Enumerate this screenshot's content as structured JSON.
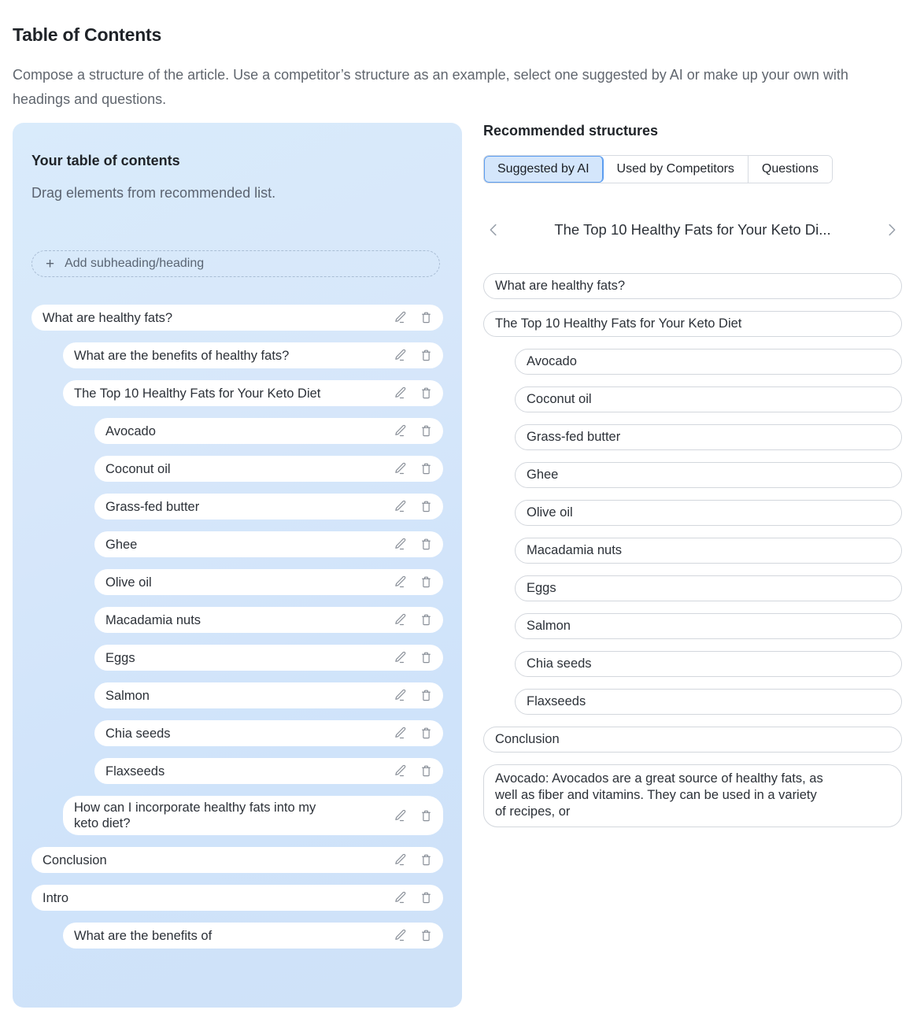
{
  "header": {
    "title": "Table of Contents",
    "description": "Compose a structure of the article. Use a competitor’s structure as an example, select one suggested by AI or make up your own with headings and questions."
  },
  "left_panel": {
    "title": "Your table of contents",
    "subtitle": "Drag elements from recommended list.",
    "add_button_label": "Add subheading/heading",
    "add_button_plus": "+",
    "edit_icon": "pencil-icon",
    "delete_icon": "trash-icon",
    "items": [
      {
        "label": "What are healthy fats?",
        "indent": 0
      },
      {
        "label": "What are the benefits of healthy fats?",
        "indent": 1
      },
      {
        "label": "The Top 10 Healthy Fats for Your Keto Diet",
        "indent": 1
      },
      {
        "label": "Avocado",
        "indent": 2
      },
      {
        "label": "Coconut oil",
        "indent": 2
      },
      {
        "label": "Grass-fed butter",
        "indent": 2
      },
      {
        "label": "Ghee",
        "indent": 2
      },
      {
        "label": "Olive oil",
        "indent": 2
      },
      {
        "label": "Macadamia nuts",
        "indent": 2
      },
      {
        "label": "Eggs",
        "indent": 2
      },
      {
        "label": "Salmon",
        "indent": 2
      },
      {
        "label": "Chia seeds",
        "indent": 2
      },
      {
        "label": "Flaxseeds",
        "indent": 2
      },
      {
        "label": "How can I incorporate healthy fats into my\nketo diet?",
        "indent": 1
      },
      {
        "label": "Conclusion",
        "indent": 0
      },
      {
        "label": "Intro",
        "indent": 0
      },
      {
        "label": "What are the benefits of",
        "indent": 1
      }
    ]
  },
  "right_panel": {
    "title": "Recommended structures",
    "tabs": [
      {
        "label": "Suggested by AI",
        "active": true
      },
      {
        "label": "Used by Competitors",
        "active": false
      },
      {
        "label": "Questions",
        "active": false
      }
    ],
    "carousel": {
      "prev_icon": "chevron-left-icon",
      "next_icon": "chevron-right-icon",
      "title": "The Top 10 Healthy Fats for Your Keto Di..."
    },
    "items": [
      {
        "label": "What are healthy fats?",
        "indent": 0
      },
      {
        "label": "The Top 10 Healthy Fats for Your Keto Diet",
        "indent": 0
      },
      {
        "label": "Avocado",
        "indent": 1
      },
      {
        "label": "Coconut oil",
        "indent": 1
      },
      {
        "label": "Grass-fed butter",
        "indent": 1
      },
      {
        "label": "Ghee",
        "indent": 1
      },
      {
        "label": "Olive oil",
        "indent": 1
      },
      {
        "label": "Macadamia nuts",
        "indent": 1
      },
      {
        "label": "Eggs",
        "indent": 1
      },
      {
        "label": "Salmon",
        "indent": 1
      },
      {
        "label": "Chia seeds",
        "indent": 1
      },
      {
        "label": "Flaxseeds",
        "indent": 1
      },
      {
        "label": "Conclusion",
        "indent": 0
      },
      {
        "label": "Avocado: Avocados are a great source of healthy fats, as\nwell as fiber and vitamins. They can be used in a variety\nof recipes, or",
        "indent": 0,
        "multiline": true
      }
    ]
  },
  "colors": {
    "panel_bg_start": "#d9ebfb",
    "panel_bg_end": "#cfe2f8",
    "tab_active_bg": "#d4e6fb",
    "tab_active_border": "#5b9df0",
    "text_primary": "#1f2328",
    "text_secondary": "#60666e",
    "icon_grey": "#8a9099"
  }
}
